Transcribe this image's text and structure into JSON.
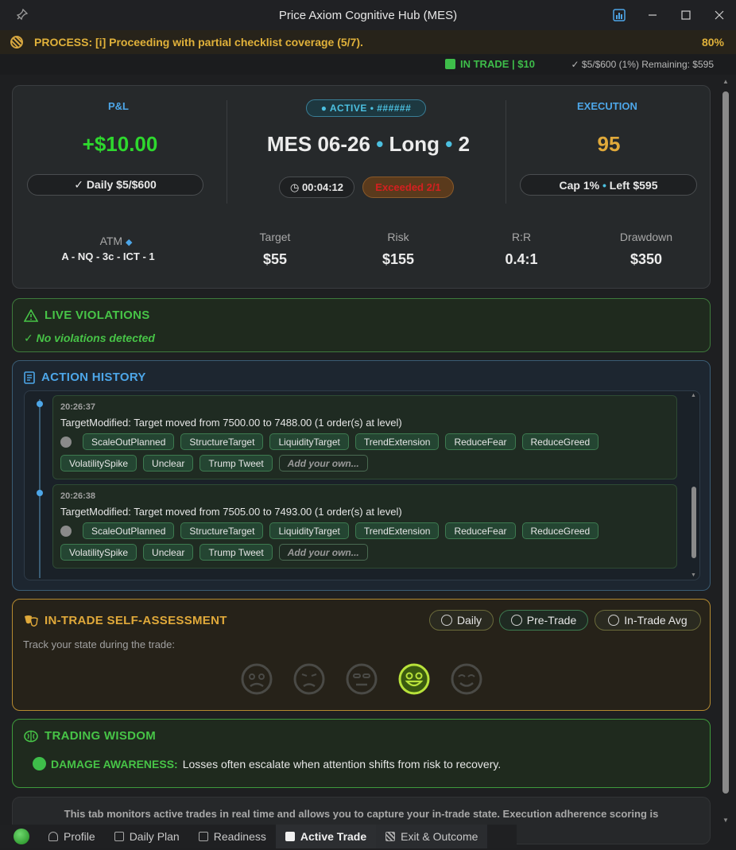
{
  "window": {
    "title": "Price Axiom Cognitive Hub (MES)",
    "icons": [
      "pin-icon",
      "chart-icon",
      "minimize-icon",
      "maximize-icon",
      "close-icon"
    ]
  },
  "process": {
    "text": "PROCESS: [i] Proceeding with partial checklist coverage (5/7).",
    "percent": "80%"
  },
  "status": {
    "in_trade": "IN TRADE | $10",
    "remaining": "✓ $5/$600 (1%) Remaining: $595"
  },
  "header": {
    "pnl_label": "P&L",
    "pnl_value": "+$10.00",
    "daily_pill": "✓ Daily $5/$600",
    "active_badge": "● ACTIVE • ######",
    "instrument": "MES 06-26",
    "direction": "Long",
    "quantity": "2",
    "timer": "◷ 00:04:12",
    "exceeded": "Exceeded 2/1",
    "execution_label": "EXECUTION",
    "execution_value": "95",
    "cap_pill": "Cap 1%",
    "left_pill": "Left $595",
    "atm_label": "ATM",
    "atm_value": "A - NQ - 3c  - ICT - 1",
    "metrics": [
      {
        "label": "Target",
        "value": "$55"
      },
      {
        "label": "Risk",
        "value": "$155"
      },
      {
        "label": "R:R",
        "value": "0.4:1"
      },
      {
        "label": "Drawdown",
        "value": "$350"
      }
    ],
    "colors": {
      "pnl": "#2ed82e",
      "execution": "#e0a93a",
      "accent": "#4da6e8",
      "exceeded": "#d42020"
    }
  },
  "violations": {
    "title": "LIVE VIOLATIONS",
    "message": "✓ No violations detected"
  },
  "history": {
    "title": "ACTION HISTORY",
    "entries": [
      {
        "time": "20:26:37",
        "message": "TargetModified: Target moved from 7500.00 to 7488.00 (1 order(s) at level)",
        "tags": [
          "ScaleOutPlanned",
          "StructureTarget",
          "LiquidityTarget",
          "TrendExtension",
          "ReduceFear",
          "ReduceGreed",
          "VolatilitySpike",
          "Unclear",
          "Trump Tweet"
        ],
        "add_own": "Add your own..."
      },
      {
        "time": "20:26:38",
        "message": "TargetModified: Target moved from 7505.00 to 7493.00 (1 order(s) at level)",
        "tags": [
          "ScaleOutPlanned",
          "StructureTarget",
          "LiquidityTarget",
          "TrendExtension",
          "ReduceFear",
          "ReduceGreed",
          "VolatilitySpike",
          "Unclear",
          "Trump Tweet"
        ],
        "add_own": "Add your own..."
      }
    ]
  },
  "assessment": {
    "title": "IN-TRADE SELF-ASSESSMENT",
    "subtitle": "Track your state during the trade:",
    "buttons": [
      "Daily",
      "Pre-Trade",
      "In-Trade Avg"
    ],
    "faces": [
      "anxious-face-icon",
      "sad-face-icon",
      "neutral-face-icon",
      "happy-face-icon",
      "content-face-icon"
    ],
    "selected_face": 3
  },
  "wisdom": {
    "title": "TRADING WISDOM",
    "key": "DAMAGE AWARENESS:",
    "text": "Losses often escalate when attention shifts from risk to recovery."
  },
  "info": {
    "text": "This tab monitors active trades in real time and allows you to capture your in-trade state. Execution adherence scoring is"
  },
  "tabs": [
    {
      "label": "Profile",
      "icon": "person-icon"
    },
    {
      "label": "Daily Plan",
      "icon": "clipboard-icon"
    },
    {
      "label": "Readiness",
      "icon": "checkbox-icon"
    },
    {
      "label": "Active Trade",
      "icon": "trade-icon",
      "active": true
    },
    {
      "label": "Exit & Outcome",
      "icon": "flag-icon"
    }
  ]
}
